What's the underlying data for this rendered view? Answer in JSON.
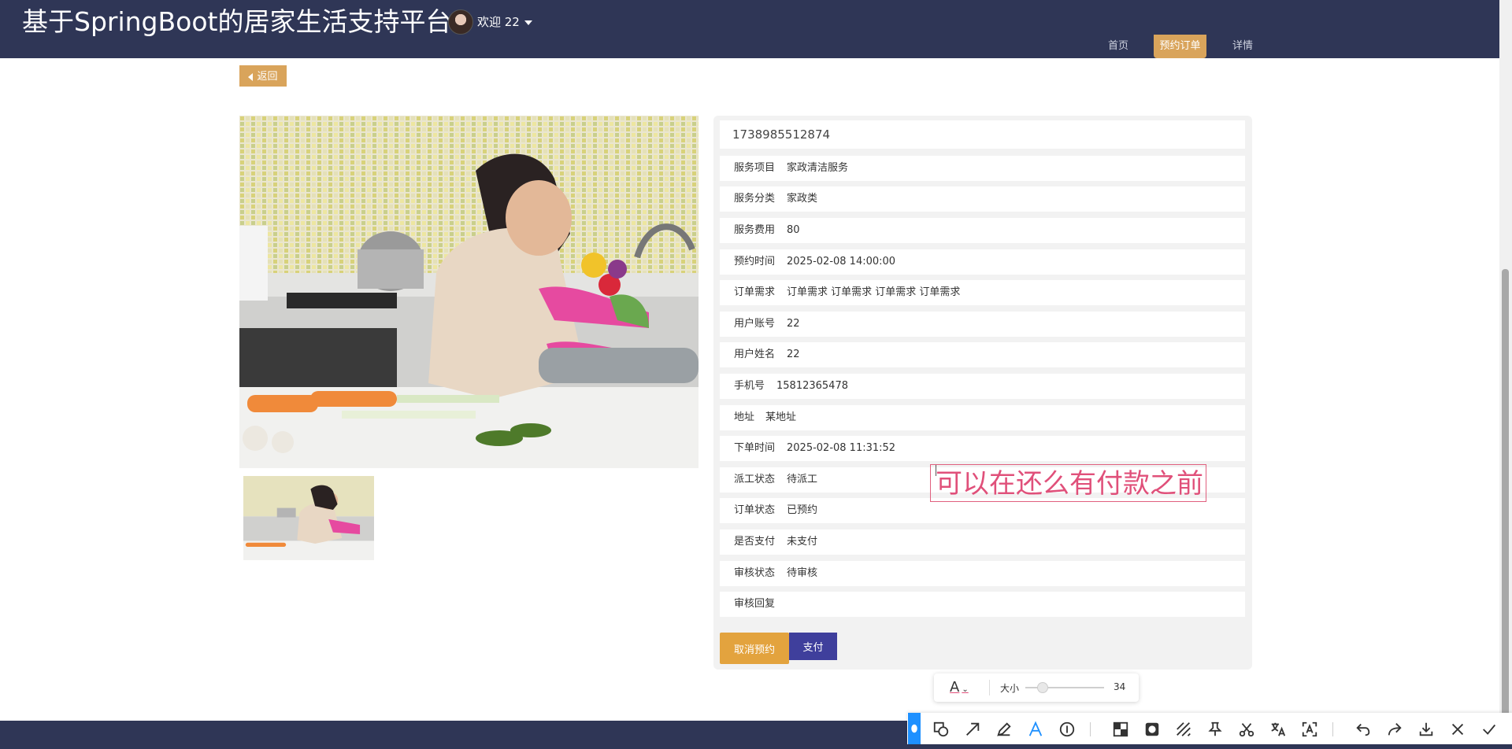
{
  "header": {
    "site_title": "基于SpringBoot的居家生活支持平台",
    "welcome": "欢迎 22",
    "nav": [
      {
        "label": "首页",
        "active": false
      },
      {
        "label": "预约订单",
        "active": true
      },
      {
        "label": "详情",
        "active": false
      }
    ]
  },
  "back_button": "返回",
  "order_no": "1738985512874",
  "details": [
    {
      "label": "服务项目",
      "value": "家政清洁服务"
    },
    {
      "label": "服务分类",
      "value": "家政类"
    },
    {
      "label": "服务费用",
      "value": "80"
    },
    {
      "label": "预约时间",
      "value": "2025-02-08 14:00:00"
    },
    {
      "label": "订单需求",
      "value": "订单需求 订单需求 订单需求 订单需求"
    },
    {
      "label": "用户账号",
      "value": "22"
    },
    {
      "label": "用户姓名",
      "value": "22"
    },
    {
      "label": "手机号",
      "value": "15812365478"
    },
    {
      "label": "地址",
      "value": "某地址"
    },
    {
      "label": "下单时间",
      "value": "2025-02-08 11:31:52"
    },
    {
      "label": "派工状态",
      "value": "待派工"
    },
    {
      "label": "订单状态",
      "value": "已预约"
    },
    {
      "label": "是否支付",
      "value": "未支付"
    },
    {
      "label": "审核状态",
      "value": "待审核"
    },
    {
      "label": "审核回复",
      "value": ""
    }
  ],
  "actions": {
    "cancel": "取消预约",
    "pay": "支付"
  },
  "annotation_text": "可以在还么有付款之前",
  "text_tool": {
    "font_letter": "A",
    "size_label": "大小",
    "size_value": "34",
    "size_fraction": 0.22
  },
  "colors": {
    "header_bg": "#2f3656",
    "accent_gold": "#d9a45b",
    "pay_blue": "#3f3f9c",
    "annotation_pink": "#e0507a"
  },
  "toolbar_icons": [
    "qq-icon",
    "shape-icon",
    "arrow-icon",
    "pen-icon",
    "text-icon",
    "number-icon",
    "mosaic-icon",
    "blur-icon",
    "hatch-icon",
    "pin-icon",
    "scissors-icon",
    "translate-icon",
    "ocr-icon",
    "undo-icon",
    "redo-icon",
    "download-icon",
    "close-icon",
    "confirm-icon"
  ]
}
